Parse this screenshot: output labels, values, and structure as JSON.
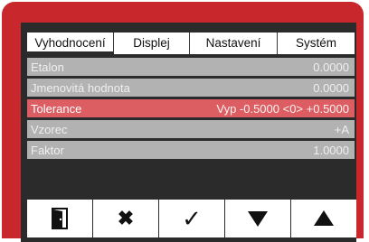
{
  "tabs": [
    {
      "label": "Vyhodnocení",
      "active": true
    },
    {
      "label": "Displej",
      "active": false
    },
    {
      "label": "Nastavení",
      "active": false
    },
    {
      "label": "Systém",
      "active": false
    }
  ],
  "rows": [
    {
      "label": "Etalon",
      "value": "0.0000",
      "selected": false
    },
    {
      "label": "Jmenovitá hodnota",
      "value": "0.0000",
      "selected": false
    },
    {
      "label": "Tolerance",
      "value": "Vyp -0.5000 <0> +0.5000",
      "selected": true
    },
    {
      "label": "Vzorec",
      "value": "+A",
      "selected": false
    },
    {
      "label": "Faktor",
      "value": "1.0000",
      "selected": false
    }
  ],
  "buttons": [
    {
      "icon": "exit-door-icon",
      "glyph": ""
    },
    {
      "icon": "close-icon",
      "glyph": "✖"
    },
    {
      "icon": "checkmark-icon",
      "glyph": "✓"
    },
    {
      "icon": "arrow-down-icon",
      "glyph": ""
    },
    {
      "icon": "arrow-up-icon",
      "glyph": ""
    }
  ],
  "colors": {
    "frame": "#c8282c",
    "screen_bg": "#2b2b2b",
    "row_bg": "#b2b2b2",
    "row_selected_bg": "#dd5e62"
  }
}
